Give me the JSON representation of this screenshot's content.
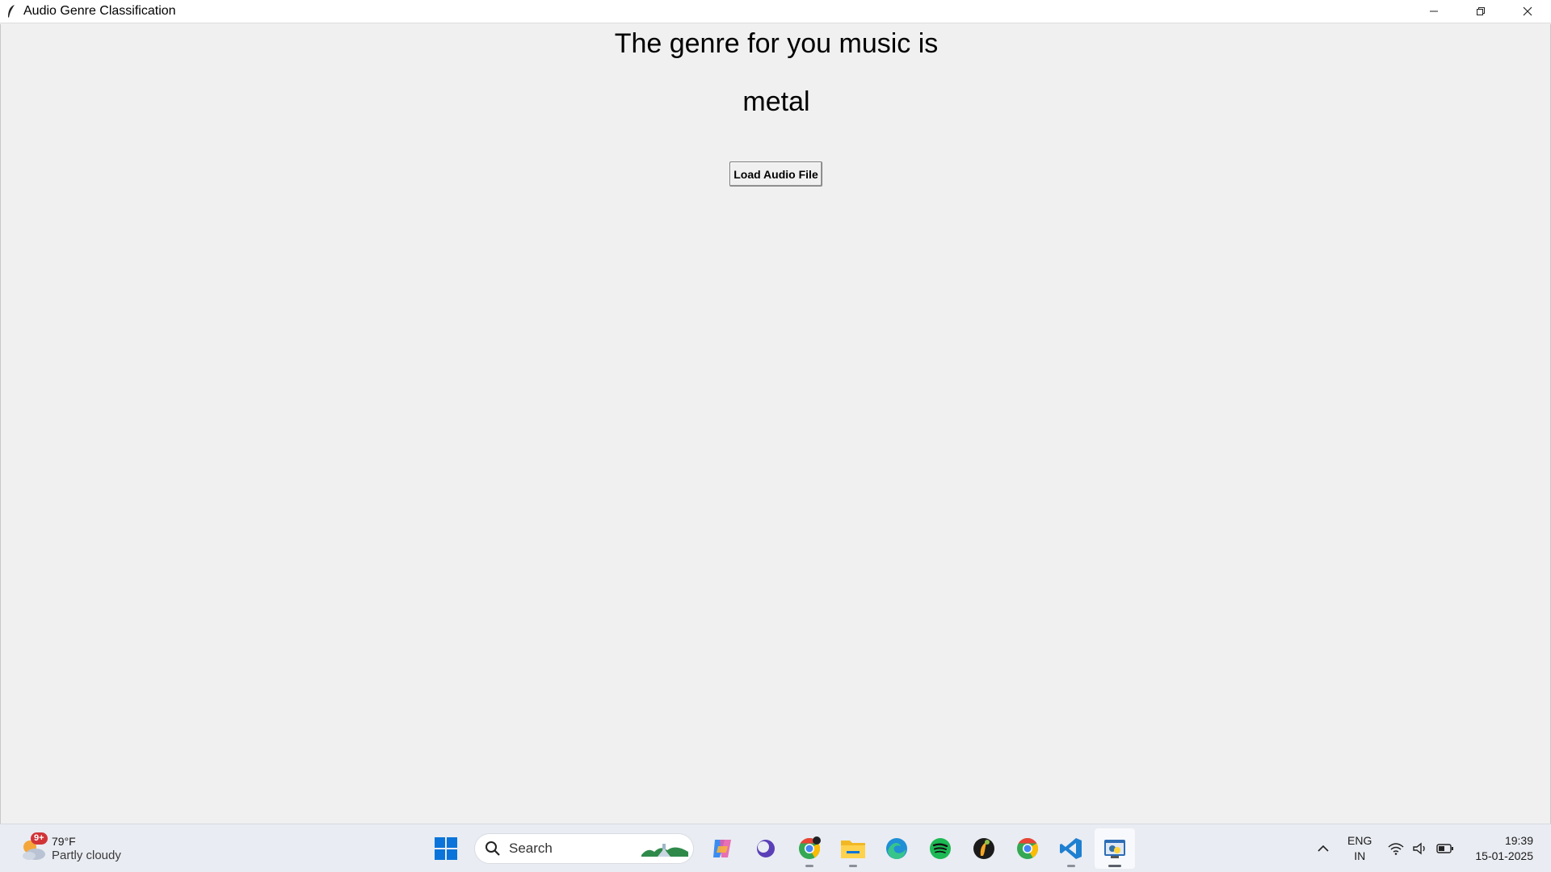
{
  "window": {
    "title": "Audio Genre Classification",
    "controls": [
      "minimize-icon",
      "restore-icon",
      "close-icon"
    ]
  },
  "main": {
    "headline": "The genre for you music is",
    "result": "metal",
    "load_button_label": "Load Audio File"
  },
  "taskbar": {
    "weather": {
      "badge": "9+",
      "temperature": "79°F",
      "condition": "Partly cloudy"
    },
    "search_placeholder": "Search",
    "apps": [
      "windows-start-icon",
      "copilot-icon",
      "obsidian-icon",
      "chrome-icon",
      "file-explorer-icon",
      "edge-icon",
      "spotify-icon",
      "fl-studio-icon",
      "chrome-profile-icon",
      "vscode-icon",
      "python-app-icon"
    ],
    "tray": {
      "lang_line1": "ENG",
      "lang_line2": "IN",
      "time": "19:39",
      "date": "15-01-2025"
    }
  },
  "colors": {
    "window_bg": "#f0f0f0",
    "taskbar_bg": "#e9ecf2",
    "accent": "#0078d4"
  }
}
